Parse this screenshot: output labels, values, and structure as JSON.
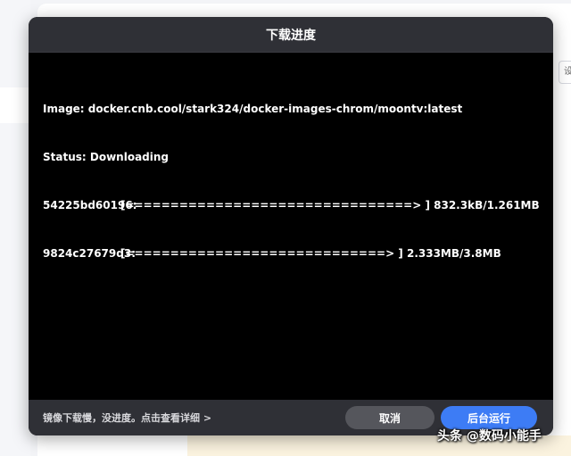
{
  "background": {
    "right_button_text": "设"
  },
  "dialog": {
    "title": "下载进度",
    "terminal": {
      "image_line": "Image: docker.cnb.cool/stark324/docker-images-chrom/moontv:latest",
      "status_line": "Status: Downloading",
      "layers": [
        {
          "id": "54225bd60196:",
          "bar": "[================================> ] 832.3kB/1.261MB",
          "progress": 0.66
        },
        {
          "id": "9824c27679d3:",
          "bar": "[=============================> ] 2.333MB/3.8MB",
          "progress": 0.61
        }
      ]
    },
    "footer": {
      "hint": "镜像下载慢，没进度。点击查看详细 >",
      "cancel_label": "取消",
      "background_run_label": "后台运行"
    }
  },
  "watermark": "头条 @数码小能手",
  "colors": {
    "dialog_bg": "#000000",
    "header_bg": "#2f3036",
    "primary": "#3d7cf5",
    "cancel": "#55565c"
  }
}
